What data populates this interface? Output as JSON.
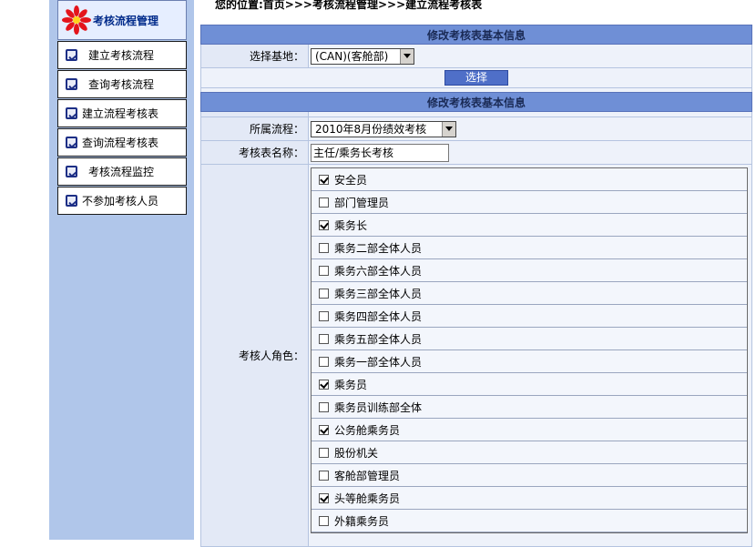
{
  "breadcrumb": "您的位置:首页>>>考核流程管理>>>建立流程考核表",
  "nav": {
    "title": "考核流程管理",
    "items": [
      {
        "label": "建立考核流程",
        "name": "nav-item-create-process"
      },
      {
        "label": "查询考核流程",
        "name": "nav-item-query-process"
      },
      {
        "label": "建立流程考核表",
        "name": "nav-item-create-form"
      },
      {
        "label": "查询流程考核表",
        "name": "nav-item-query-form"
      },
      {
        "label": "考核流程监控",
        "name": "nav-item-monitor"
      },
      {
        "label": "不参加考核人员",
        "name": "nav-item-exclude"
      }
    ]
  },
  "section1": {
    "title": "修改考核表基本信息",
    "base_label": "选择基地：",
    "base_value": "(CAN)(客舱部)",
    "select_button": "选择"
  },
  "section2": {
    "title": "修改考核表基本信息",
    "process_label": "所属流程：",
    "process_value": "2010年8月份绩效考核",
    "form_name_label": "考核表名称：",
    "form_name_value": "主任/乘务长考核",
    "roles_label": "考核人角色：",
    "roles": [
      {
        "label": "安全员",
        "checked": true
      },
      {
        "label": "部门管理员",
        "checked": false
      },
      {
        "label": "乘务长",
        "checked": true
      },
      {
        "label": "乘务二部全体人员",
        "checked": false
      },
      {
        "label": "乘务六部全体人员",
        "checked": false
      },
      {
        "label": "乘务三部全体人员",
        "checked": false
      },
      {
        "label": "乘务四部全体人员",
        "checked": false
      },
      {
        "label": "乘务五部全体人员",
        "checked": false
      },
      {
        "label": "乘务一部全体人员",
        "checked": false
      },
      {
        "label": "乘务员",
        "checked": true
      },
      {
        "label": "乘务员训练部全体",
        "checked": false
      },
      {
        "label": "公务舱乘务员",
        "checked": true
      },
      {
        "label": "股份机关",
        "checked": false
      },
      {
        "label": "客舱部管理员",
        "checked": false
      },
      {
        "label": "头等舱乘务员",
        "checked": true
      },
      {
        "label": "外籍乘务员",
        "checked": false
      }
    ]
  }
}
